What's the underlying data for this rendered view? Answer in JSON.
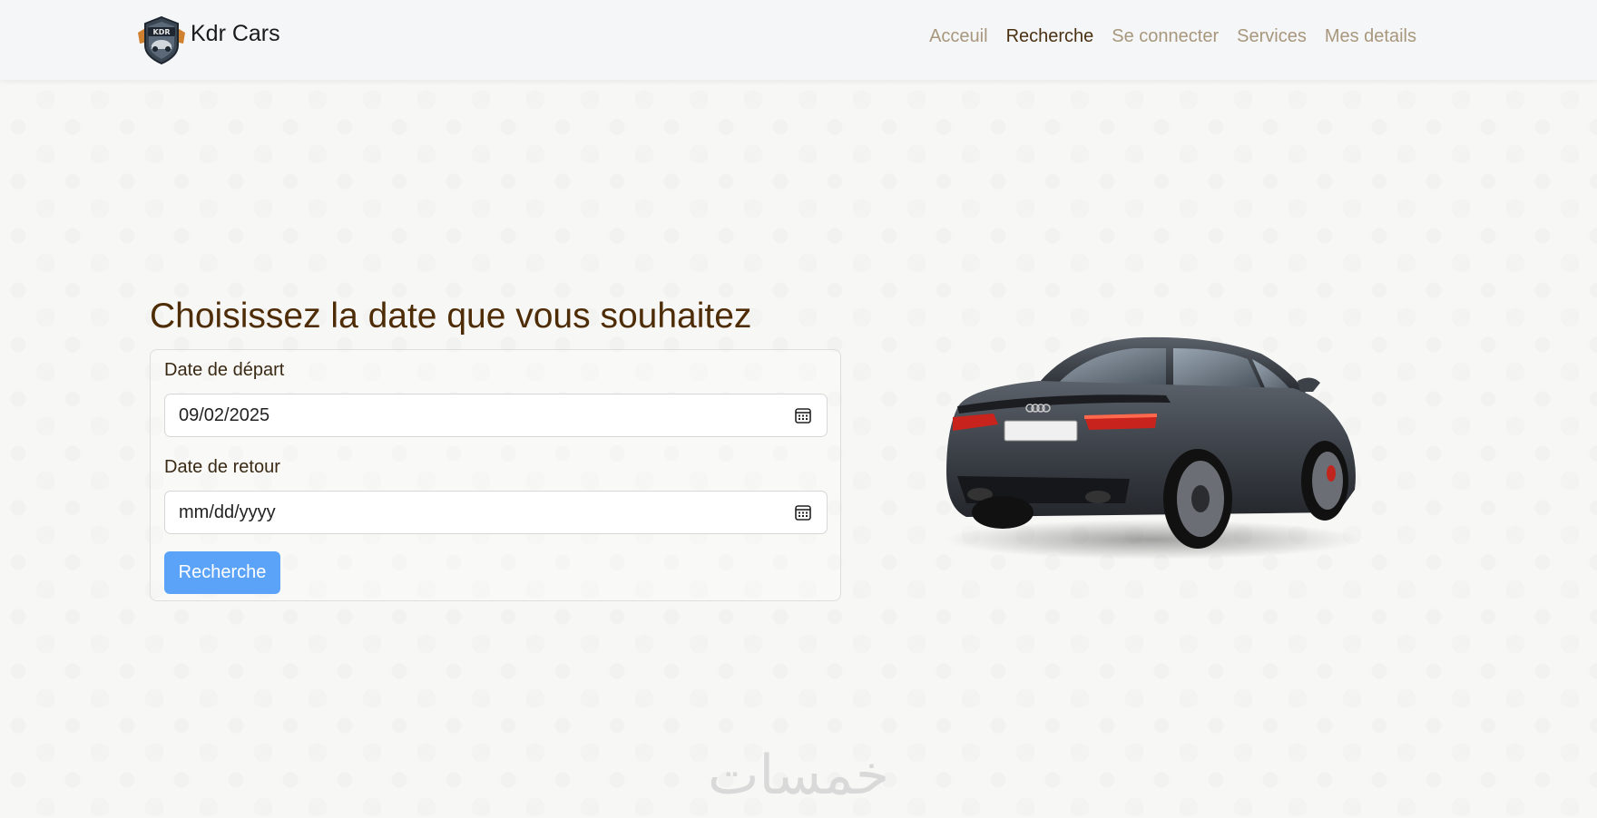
{
  "header": {
    "brand_name": "Kdr Cars",
    "logo_text": "KDR",
    "nav": [
      {
        "label": "Acceuil",
        "active": false
      },
      {
        "label": "Recherche",
        "active": true
      },
      {
        "label": "Se connecter",
        "active": false
      },
      {
        "label": "Services",
        "active": false
      },
      {
        "label": "Mes details",
        "active": false
      }
    ]
  },
  "main": {
    "title": "Choisissez la date que vous souhaitez",
    "form": {
      "departure_label": "Date de départ",
      "departure_value": "09/02/2025",
      "return_label": "Date de retour",
      "return_placeholder": "mm/dd/yyyy",
      "submit_label": "Recherche"
    }
  },
  "watermark": "خمسات",
  "colors": {
    "accent": "#5ba3f8",
    "title": "#4e2c06",
    "nav_inactive": "#a8977c",
    "nav_active": "#4a3010"
  },
  "icons": {
    "logo": "kdr-badge-icon",
    "calendar": "calendar-icon"
  }
}
